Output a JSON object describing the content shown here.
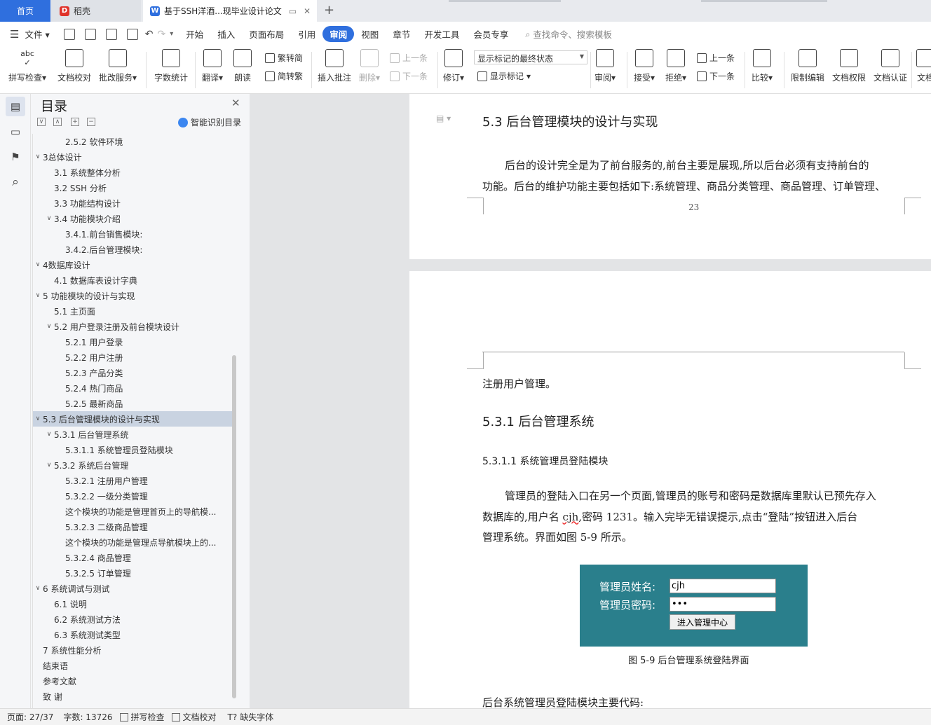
{
  "tabs": {
    "home": "首页",
    "daoke": "稻壳",
    "doc": "基于SSH洋酒...现毕业设计论文"
  },
  "menu": {
    "file": "文件",
    "items": [
      "开始",
      "插入",
      "页面布局",
      "引用",
      "审阅",
      "视图",
      "章节",
      "开发工具",
      "会员专享"
    ],
    "active": "审阅",
    "search": "查找命令、搜索模板"
  },
  "ribbon": {
    "spell": "拼写检查",
    "doc_check": "文档校对",
    "batch": "批改服务",
    "word_count": "字数统计",
    "translate": "翻译",
    "read": "朗读",
    "trad_simp": "繁转简",
    "simp_trad": "简转繁",
    "insert_comment": "插入批注",
    "delete": "删除",
    "prev_comment": "上一条",
    "next_comment": "下一条",
    "revise": "修订",
    "markup_state": "显示标记的最终状态",
    "show_markup": "显示标记",
    "review": "审阅",
    "accept": "接受",
    "reject": "拒绝",
    "prev_change": "上一条",
    "next_change": "下一条",
    "compare": "比较",
    "restrict": "限制编辑",
    "doc_rights": "文档权限",
    "doc_cert": "文档认证",
    "doc_cut": "文档"
  },
  "toc": {
    "title": "目录",
    "smart": "智能识别目录",
    "items": [
      {
        "text": "2.5.2    软件环境",
        "level": 3,
        "tw": ""
      },
      {
        "text": "3总体设计",
        "level": 1,
        "tw": "v"
      },
      {
        "text": "3.1    系统整体分析",
        "level": 2,
        "tw": ""
      },
      {
        "text": "3.2    SSH 分析",
        "level": 2,
        "tw": ""
      },
      {
        "text": "3.3    功能结构设计",
        "level": 2,
        "tw": ""
      },
      {
        "text": "3.4    功能模块介绍",
        "level": 2,
        "tw": "v"
      },
      {
        "text": "3.4.1.前台销售模块:",
        "level": 3,
        "tw": ""
      },
      {
        "text": "3.4.2.后台管理模块:",
        "level": 3,
        "tw": ""
      },
      {
        "text": "4数据库设计",
        "level": 1,
        "tw": "v"
      },
      {
        "text": "4.1    数据库表设计字典",
        "level": 2,
        "tw": ""
      },
      {
        "text": "5    功能模块的设计与实现",
        "level": 1,
        "tw": "v"
      },
      {
        "text": "5.1    主页面",
        "level": 2,
        "tw": ""
      },
      {
        "text": "5.2    用户登录注册及前台模块设计",
        "level": 2,
        "tw": "v"
      },
      {
        "text": "5.2.1    用户登录",
        "level": 3,
        "tw": ""
      },
      {
        "text": "5.2.2    用户注册",
        "level": 3,
        "tw": ""
      },
      {
        "text": "5.2.3    产品分类",
        "level": 3,
        "tw": ""
      },
      {
        "text": "5.2.4    热门商品",
        "level": 3,
        "tw": ""
      },
      {
        "text": "5.2.5    最新商品",
        "level": 3,
        "tw": ""
      },
      {
        "text": "5.3  后台管理模块的设计与实现",
        "level": 1,
        "tw": "v",
        "selected": true
      },
      {
        "text": "5.3.1    后台管理系统",
        "level": 2,
        "tw": "v"
      },
      {
        "text": "5.3.1.1    系统管理员登陆模块",
        "level": 3,
        "tw": ""
      },
      {
        "text": "5.3.2    系统后台管理",
        "level": 2,
        "tw": "v"
      },
      {
        "text": "5.3.2.1    注册用户管理",
        "level": 3,
        "tw": ""
      },
      {
        "text": "5.3.2.2    一级分类管理",
        "level": 3,
        "tw": ""
      },
      {
        "text": "这个模块的功能是管理首页上的导航模...",
        "level": 3,
        "tw": ""
      },
      {
        "text": "5.3.2.3    二级商品管理",
        "level": 3,
        "tw": ""
      },
      {
        "text": "这个模块的功能是管理点导航模块上的...",
        "level": 3,
        "tw": ""
      },
      {
        "text": "5.3.2.4    商品管理",
        "level": 3,
        "tw": ""
      },
      {
        "text": "5.3.2.5    订单管理",
        "level": 3,
        "tw": ""
      },
      {
        "text": "6    系统调试与测试",
        "level": 1,
        "tw": "v"
      },
      {
        "text": "6.1    说明",
        "level": 2,
        "tw": ""
      },
      {
        "text": "6.2    系统测试方法",
        "level": 2,
        "tw": ""
      },
      {
        "text": "6.3    系统测试类型",
        "level": 2,
        "tw": ""
      },
      {
        "text": "7    系统性能分析",
        "level": 1,
        "tw": ""
      },
      {
        "text": "结束语",
        "level": 1,
        "tw": ""
      },
      {
        "text": "参考文献",
        "level": 1,
        "tw": ""
      },
      {
        "text": "致        谢",
        "level": 1,
        "tw": ""
      }
    ]
  },
  "doc": {
    "page1": {
      "heading": "5.3 后台管理模块的设计与实现",
      "para_line1": "后台的设计完全是为了前台服务的,前台主要是展现,所以后台必须有支持前台的",
      "para_line2": "功能。后台的维护功能主要包括如下:系统管理、商品分类管理、商品管理、订单管理、",
      "page_number": "23"
    },
    "page2": {
      "cont": "注册用户管理。",
      "h2": "5.3.1    后台管理系统",
      "h3": "5.3.1.1    系统管理员登陆模块",
      "p1_line1": "管理员的登陆入口在另一个页面,管理员的账号和密码是数据库里默认已预先存入",
      "p1_line2_a": "数据库的,用户名 ",
      "p1_line2_cjh": "cjh",
      "p1_line2_b": ",密码 1231。输入完毕无错误提示,点击“登陆”按钮进入后台",
      "p1_line3": "管理系统。界面如图 5-9 所示。",
      "fig": {
        "user_label": "管理员姓名:",
        "user_value": "cjh",
        "pass_label": "管理员密码:",
        "pass_value": "•••",
        "button": "进入管理中心",
        "bg_color": "#2a7f8c"
      },
      "caption": "图 5-9  后台管理系统登陆界面",
      "code_intro": "后台系统管理员登陆模块主要代码:"
    }
  },
  "status": {
    "page": "页面: 27/37",
    "words": "字数: 13726",
    "spell": "拼写检查",
    "proof": "文档校对",
    "missing_font": "缺失字体"
  },
  "colors": {
    "accent": "#2f6fde",
    "toc_selected": "#c9d3e1"
  }
}
